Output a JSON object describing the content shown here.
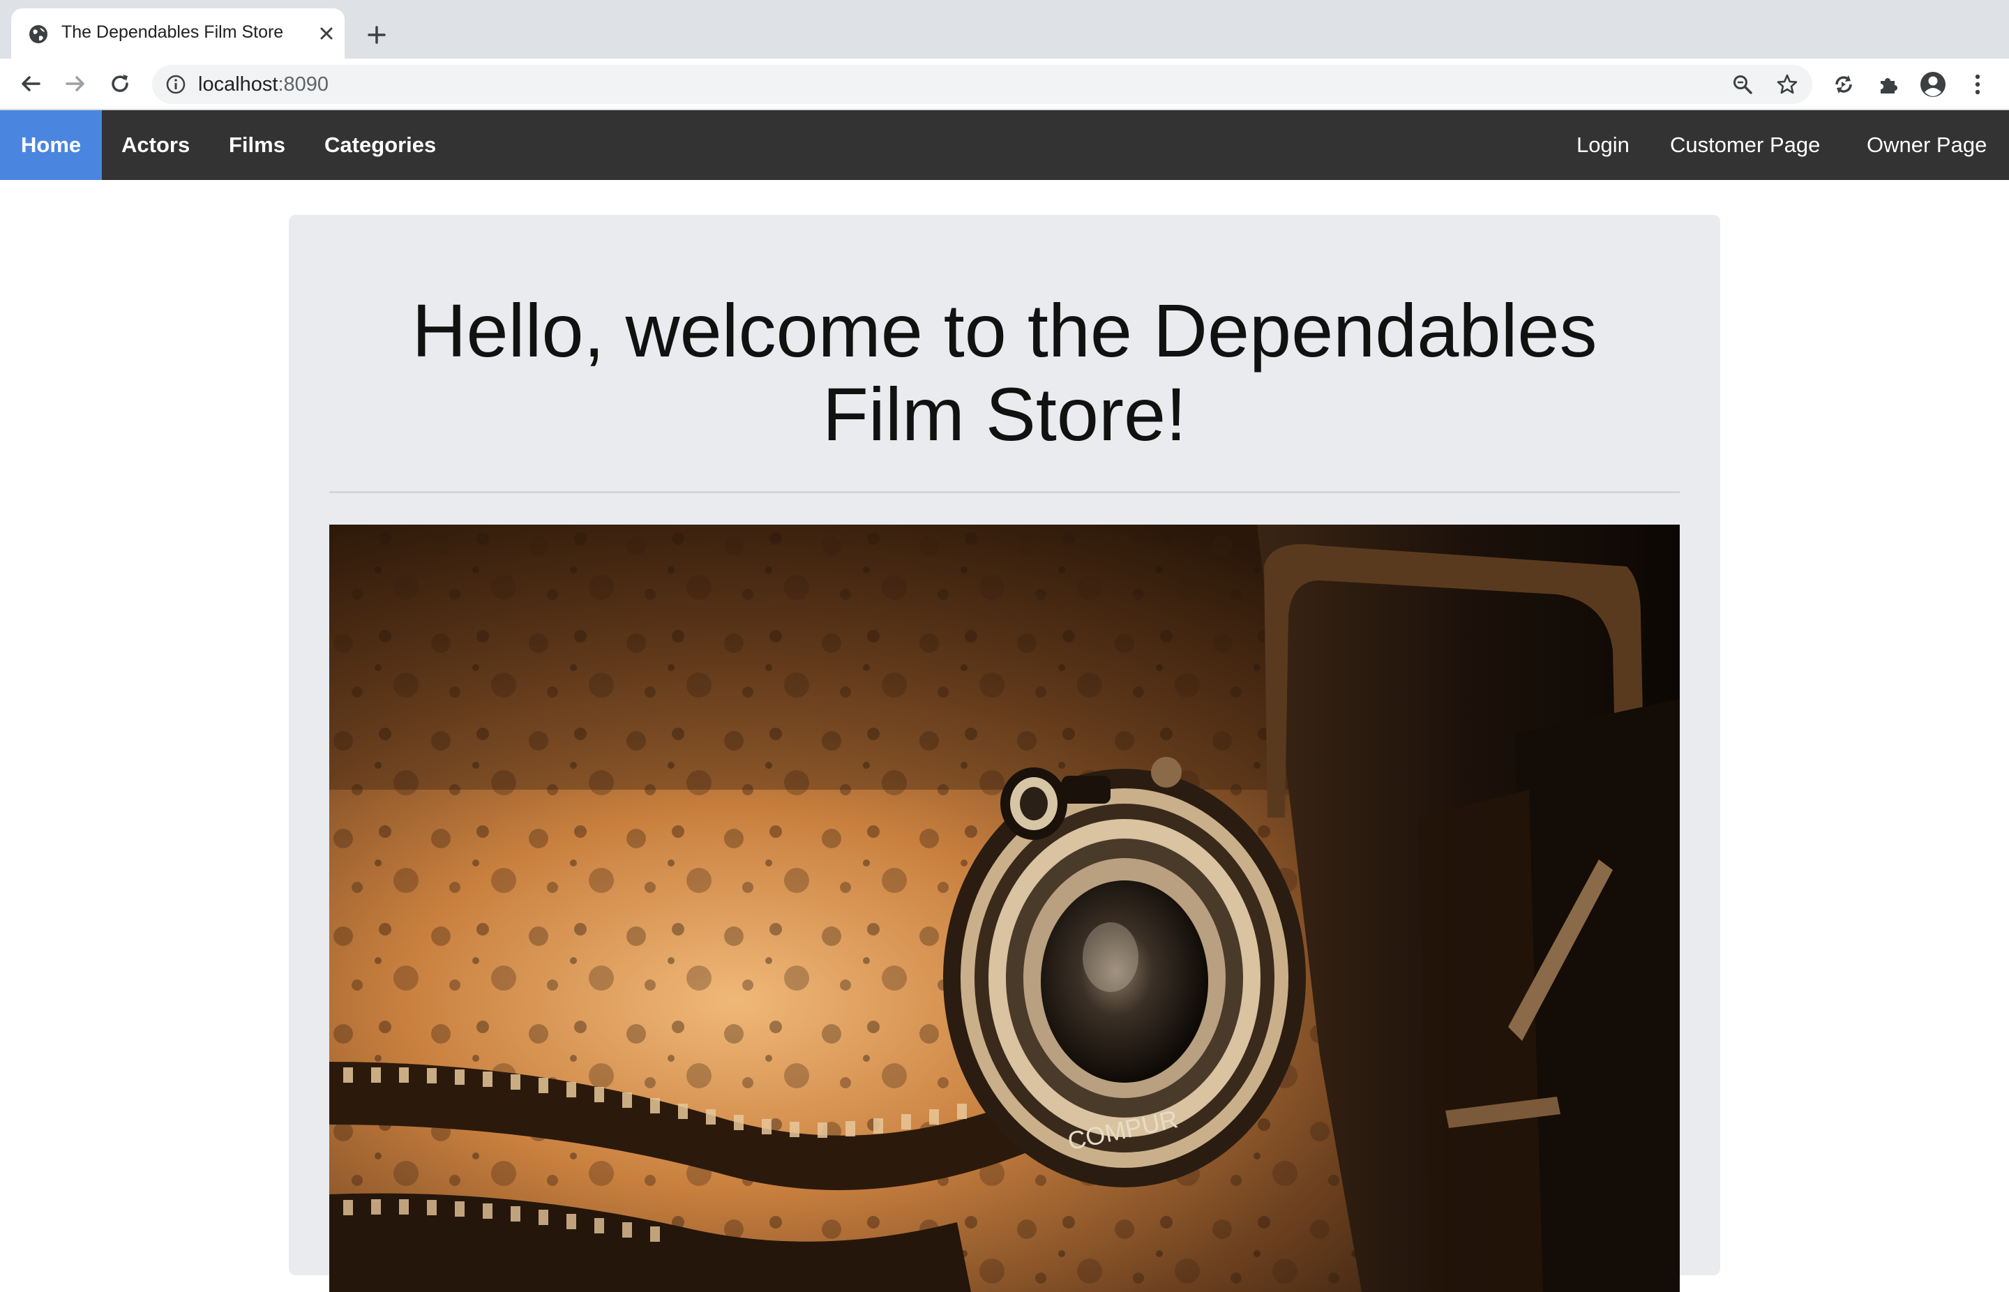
{
  "browser": {
    "tab_title": "The Dependables Film Store",
    "url_host": "localhost",
    "url_port": ":8090"
  },
  "nav": {
    "left": [
      {
        "label": "Home",
        "active": true
      },
      {
        "label": "Actors"
      },
      {
        "label": "Films"
      },
      {
        "label": "Categories"
      }
    ],
    "right": [
      {
        "label": "Login"
      },
      {
        "label": "Customer Page"
      },
      {
        "label": "Owner Page"
      }
    ]
  },
  "jumbotron": {
    "title_line1": "Hello, welcome to the Dependables",
    "title_line2": "Film Store!"
  },
  "hero_image": {
    "subject": "vintage-camera-and-film-reel-sepia",
    "lens_text": "COMPUR"
  },
  "colors": {
    "navbar_bg": "#333333",
    "active_nav_bg": "#4a86e0",
    "jumbotron_bg": "#e9ebef"
  }
}
